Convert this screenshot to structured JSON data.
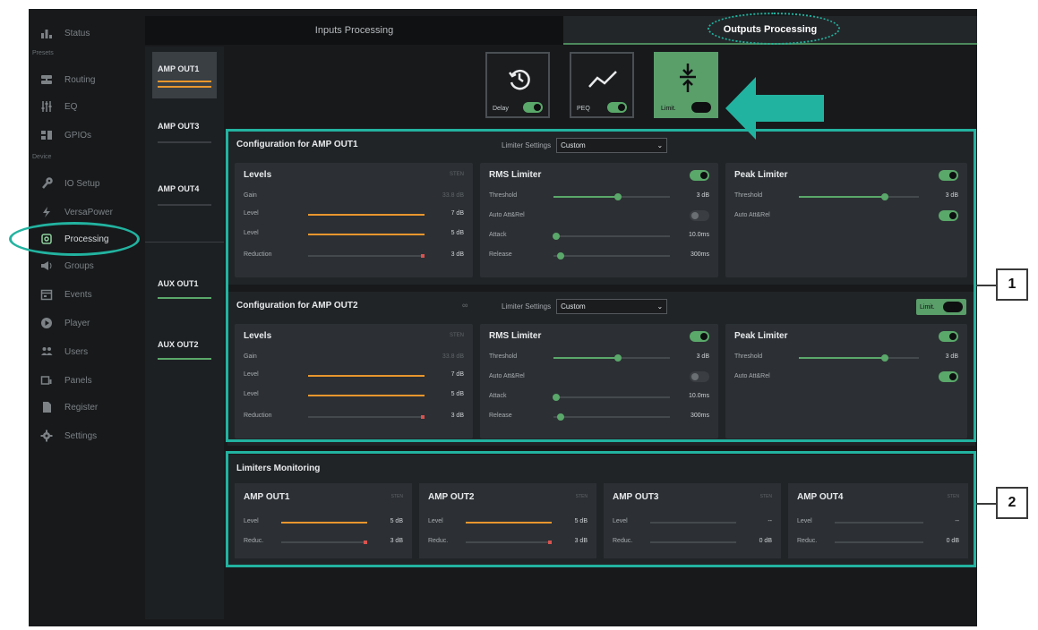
{
  "colors": {
    "accent_green": "#5aa86a",
    "level_orange": "#e8962e",
    "reduction_red": "#d9534f",
    "annotation_teal": "#22b3a0"
  },
  "sidebar": {
    "sections": [
      "Presets",
      "Device"
    ],
    "items": [
      {
        "label": "Status",
        "icon": "bars-chart-icon"
      },
      {
        "label": "Routing",
        "icon": "routing-icon"
      },
      {
        "label": "EQ",
        "icon": "eq-sliders-icon"
      },
      {
        "label": "GPIOs",
        "icon": "gpio-icon"
      },
      {
        "label": "IO Setup",
        "icon": "wrench-icon"
      },
      {
        "label": "VersaPower",
        "icon": "bolt-icon"
      },
      {
        "label": "Processing",
        "icon": "processing-icon"
      },
      {
        "label": "Groups",
        "icon": "groups-icon"
      },
      {
        "label": "Events",
        "icon": "calendar-icon"
      },
      {
        "label": "Player",
        "icon": "play-icon"
      },
      {
        "label": "Users",
        "icon": "users-icon"
      },
      {
        "label": "Panels",
        "icon": "panel-icon"
      },
      {
        "label": "Register",
        "icon": "document-icon"
      },
      {
        "label": "Settings",
        "icon": "gear-icon"
      }
    ]
  },
  "tabs": {
    "inputs": "Inputs Processing",
    "outputs": "Outputs Processing"
  },
  "channels": [
    {
      "label": "AMP OUT1",
      "active": true
    },
    {
      "label": "AMP OUT3",
      "active": false
    },
    {
      "label": "AMP OUT4",
      "active": false
    },
    {
      "label": "AUX OUT1",
      "active": false
    },
    {
      "label": "AUX OUT2",
      "active": false
    }
  ],
  "fx_buttons": {
    "delay": "Delay",
    "peq": "PEQ",
    "limit": "Limit."
  },
  "config1": {
    "title": "Configuration for AMP OUT1",
    "limiter_settings_label": "Limiter Settings",
    "limiter_settings_value": "Custom",
    "levels": {
      "title": "Levels",
      "sub": "STEN",
      "gain_label": "Gain",
      "gain_value": "33.8 dB",
      "level1_label": "Level",
      "level1_value": "7 dB",
      "level2_label": "Level",
      "level2_value": "5 dB",
      "reduction_label": "Reduction",
      "reduction_value": "3 dB"
    },
    "rms": {
      "title": "RMS Limiter",
      "threshold_label": "Threshold",
      "threshold_value": "3 dB",
      "auto_label": "Auto Att&Rel",
      "attack_label": "Attack",
      "attack_value": "10.0ms",
      "release_label": "Release",
      "release_value": "300ms"
    },
    "peak": {
      "title": "Peak Limiter",
      "threshold_label": "Threshold",
      "threshold_value": "3 dB",
      "auto_label": "Auto Att&Rel"
    }
  },
  "config2": {
    "title": "Configuration for AMP OUT2",
    "limiter_settings_label": "Limiter Settings",
    "limiter_settings_value": "Custom",
    "limit_toggle_label": "Limit.",
    "levels": {
      "title": "Levels",
      "sub": "STEN",
      "gain_label": "Gain",
      "gain_value": "33.8 dB",
      "level1_label": "Level",
      "level1_value": "7 dB",
      "level2_label": "Level",
      "level2_value": "5 dB",
      "reduction_label": "Reduction",
      "reduction_value": "3 dB"
    },
    "rms": {
      "title": "RMS Limiter",
      "threshold_label": "Threshold",
      "threshold_value": "3 dB",
      "auto_label": "Auto Att&Rel",
      "attack_label": "Attack",
      "attack_value": "10.0ms",
      "release_label": "Release",
      "release_value": "300ms"
    },
    "peak": {
      "title": "Peak Limiter",
      "threshold_label": "Threshold",
      "threshold_value": "3 dB",
      "auto_label": "Auto Att&Rel"
    }
  },
  "monitoring": {
    "title": "Limiters Monitoring",
    "cards": [
      {
        "title": "AMP OUT1",
        "sub": "STEN",
        "level_label": "Level",
        "level_value": "5 dB",
        "reduc_label": "Reduc.",
        "reduc_value": "3 dB"
      },
      {
        "title": "AMP OUT2",
        "sub": "STEN",
        "level_label": "Level",
        "level_value": "5 dB",
        "reduc_label": "Reduc.",
        "reduc_value": "3 dB"
      },
      {
        "title": "AMP OUT3",
        "sub": "STEN",
        "level_label": "Level",
        "level_value": "--",
        "reduc_label": "Reduc.",
        "reduc_value": "0 dB"
      },
      {
        "title": "AMP OUT4",
        "sub": "STEN",
        "level_label": "Level",
        "level_value": "--",
        "reduc_label": "Reduc.",
        "reduc_value": "0 dB"
      }
    ]
  },
  "annotations": {
    "callout1": "1",
    "callout2": "2"
  }
}
